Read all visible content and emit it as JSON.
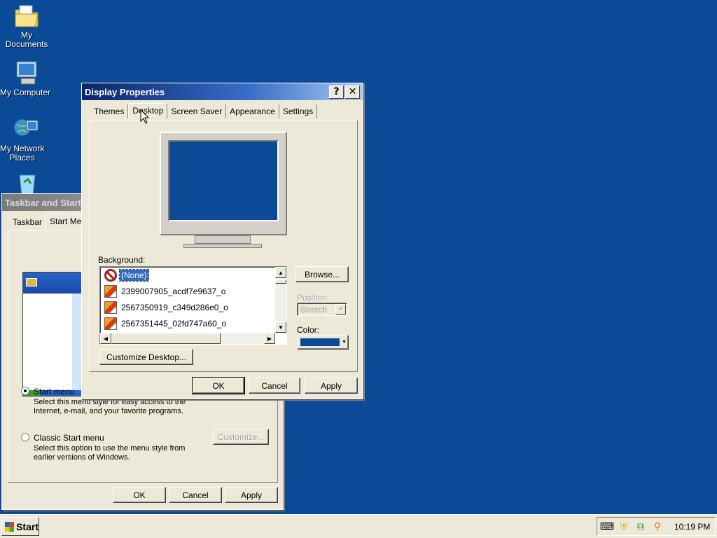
{
  "desktop_icons": [
    {
      "name": "my-documents",
      "label": "My Documents"
    },
    {
      "name": "my-computer",
      "label": "My Computer"
    },
    {
      "name": "my-network-places",
      "label": "My Network\nPlaces"
    }
  ],
  "taskbar_dialog": {
    "title": "Taskbar and Start Menu Properties",
    "tabs": [
      "Taskbar",
      "Start Menu"
    ],
    "start_menu_option": "Start menu",
    "start_menu_desc": "Select this menu style for easy access to the Internet, e-mail, and your favorite programs.",
    "classic_option": "Classic Start menu",
    "classic_desc": "Select this option to use the menu style from earlier versions of Windows.",
    "customize_label": "Customize...",
    "ok": "OK",
    "cancel": "Cancel",
    "apply": "Apply"
  },
  "display_dialog": {
    "title": "Display Properties",
    "help_glyph": "?",
    "close_glyph": "✕",
    "tabs": [
      "Themes",
      "Desktop",
      "Screen Saver",
      "Appearance",
      "Settings"
    ],
    "active_tab": "Desktop",
    "background_label": "Background:",
    "backgrounds": [
      {
        "label": "(None)",
        "selected": true
      },
      {
        "label": "2399007905_acdf7e9637_o",
        "selected": false
      },
      {
        "label": "2567350919_c349d286e0_o",
        "selected": false
      },
      {
        "label": "2567351445_02fd747a60_o",
        "selected": false
      }
    ],
    "browse": "Browse...",
    "position_label": "Position:",
    "position_value": "Stretch",
    "color_label": "Color:",
    "color_value": "#0a4a96",
    "customize_desktop": "Customize Desktop...",
    "ok": "OK",
    "cancel": "Cancel",
    "apply": "Apply"
  },
  "taskbar": {
    "start": "Start",
    "clock": "10:19 PM"
  }
}
